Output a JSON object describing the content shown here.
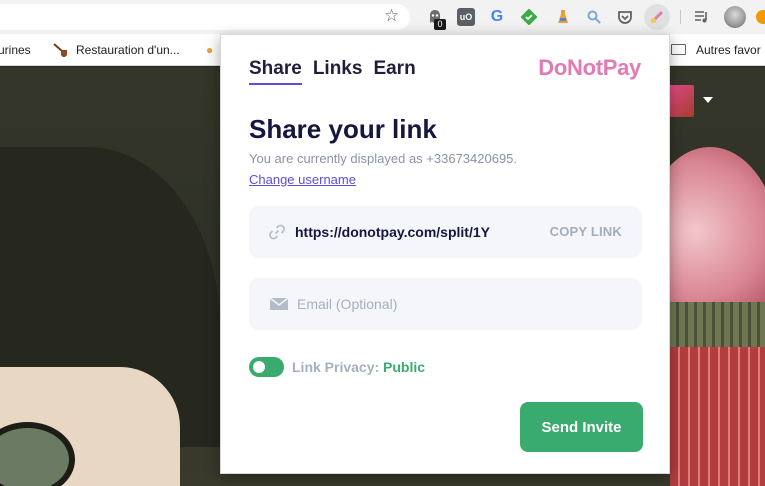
{
  "bookmarks": {
    "item_1": "urines",
    "item_2": "Restauration d'un...",
    "folder": "Autres favor"
  },
  "toolbar": {
    "extension_badge": "0",
    "google_glyph": "G"
  },
  "popup": {
    "tabs": [
      {
        "label": "Share",
        "active": true
      },
      {
        "label": "Links",
        "active": false
      },
      {
        "label": "Earn",
        "active": false
      }
    ],
    "brand": "DoNotPay",
    "heading": "Share your link",
    "display_text": "You are currently displayed as +33673420695.",
    "change_username": "Change username",
    "link_value": "https://donotpay.com/split/1Y",
    "copy_label": "COPY LINK",
    "email_placeholder": "Email (Optional)",
    "privacy_label": "Link Privacy:",
    "privacy_value": "Public",
    "privacy_on": true,
    "send_label": "Send Invite"
  },
  "colors": {
    "accent_green": "#3aab6f",
    "brand_pink": "#e27ab4",
    "tab_underline": "#5b4fd8",
    "heading": "#16163f"
  },
  "icons": [
    "star-icon",
    "link-icon",
    "mail-icon",
    "folder-icon",
    "pipe-icon",
    "caret-down-icon"
  ]
}
